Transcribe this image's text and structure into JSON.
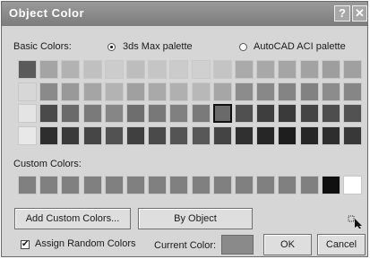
{
  "title": "Object Color",
  "titlebar": {
    "help_glyph": "?",
    "close_glyph": "✕"
  },
  "basic_label": "Basic Colors:",
  "radio_3ds": "3ds Max palette",
  "radio_autocad": "AutoCAD ACI palette",
  "custom_label": "Custom Colors:",
  "buttons": {
    "add_custom": "Add Custom Colors...",
    "by_object": "By Object",
    "ok": "OK",
    "cancel": "Cancel"
  },
  "checkbox": {
    "label": "Assign Random Colors",
    "checked": true,
    "mark": "✔"
  },
  "current_label": "Current Color:",
  "icons": {
    "help": "help-icon",
    "close": "close-icon",
    "picker": "eyedropper-icon"
  },
  "colors": {
    "current": "#8a8a8a",
    "basic_rows": [
      [
        "#5a5a5a",
        "#a4a4a4",
        "#b2b2b2",
        "#c0c0c0",
        "#cccccc",
        "#bdbdbd",
        "#c5c5c5",
        "#cbcbcb",
        "#d0d0d0",
        "#c4c4c4",
        "#aaaaaa",
        "#a8a8a8",
        "#a5a5a5",
        "#a2a2a2",
        "#9e9e9e",
        "#a0a0a0"
      ],
      [
        "#d7d7d7",
        "#8a8a8a",
        "#999999",
        "#a5a5a5",
        "#b3b3b3",
        "#a0a0a0",
        "#a9a9a9",
        "#b0b0b0",
        "#b8b8b8",
        "#a6a6a6",
        "#8c8c8c",
        "#888888",
        "#848484",
        "#828282",
        "#8c8c8c",
        "#868686"
      ],
      [
        "#e4e4e4",
        "#4a4a4a",
        "#6a6a6a",
        "#7a7a7a",
        "#868686",
        "#6e6e6e",
        "#787878",
        "#808080",
        "#7a7a7a",
        "#6a6a6a",
        "#505050",
        "#3e3e3e",
        "#3a3a3a",
        "#444444",
        "#4e4e4e",
        "#525252"
      ],
      [
        "#e8e8e8",
        "#2e2e2e",
        "#3a3a3a",
        "#464646",
        "#525252",
        "#404040",
        "#4a4a4a",
        "#545454",
        "#585858",
        "#444444",
        "#303030",
        "#262626",
        "#1e1e1e",
        "#262626",
        "#2e2e2e",
        "#383838"
      ]
    ],
    "custom": [
      "#808080",
      "#808080",
      "#808080",
      "#808080",
      "#808080",
      "#808080",
      "#808080",
      "#808080",
      "#808080",
      "#808080",
      "#808080",
      "#808080",
      "#808080",
      "#808080",
      "#101010",
      "#ffffff"
    ]
  }
}
